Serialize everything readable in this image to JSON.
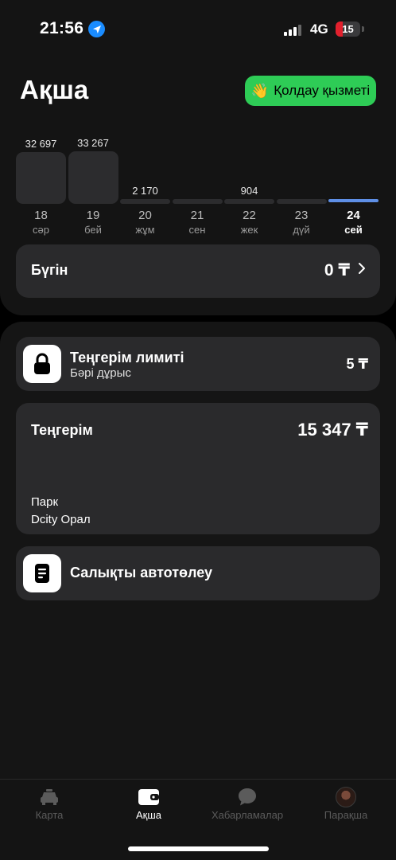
{
  "status": {
    "time": "21:56",
    "network": "4G",
    "battery": "15",
    "location_icon": "location-arrow-icon",
    "signal_icon": "cellular-signal-icon"
  },
  "header": {
    "title": "Ақша",
    "support_label": "Қолдау қызметі",
    "support_icon": "waving-hand-icon",
    "support_color": "#2ecc56"
  },
  "chart_data": {
    "type": "bar",
    "categories": [
      "18",
      "19",
      "20",
      "21",
      "22",
      "23",
      "24"
    ],
    "weekdays": [
      "сәр",
      "бей",
      "жұм",
      "сен",
      "жек",
      "дүй",
      "сей"
    ],
    "value_labels": [
      "32 697",
      "33 267",
      "2 170",
      "",
      "904",
      "",
      ""
    ],
    "values": [
      32697,
      33267,
      2170,
      0,
      904,
      0,
      0
    ],
    "selected_index": 6,
    "bar_color": "#2c2c2e",
    "selected_color": "#5e8fe6"
  },
  "today": {
    "label": "Бүгін",
    "amount": "0 ₸",
    "chevron_icon": "chevron-right-icon"
  },
  "limit_card": {
    "title": "Теңгерім лимиті",
    "subtitle": "Бәрі дұрыс",
    "amount": "5 ₸",
    "icon": "lock-icon"
  },
  "balance_card": {
    "title": "Теңгерім",
    "amount": "15 347 ₸",
    "park_label": "Парк",
    "park_value": "Dcity Орал"
  },
  "tax_card": {
    "title": "Салықты автотөлеу",
    "icon": "document-icon"
  },
  "tabs": [
    {
      "label": "Карта",
      "icon": "car-icon",
      "active": false
    },
    {
      "label": "Ақша",
      "icon": "wallet-icon",
      "active": true
    },
    {
      "label": "Хабарламалар",
      "icon": "chat-bubble-icon",
      "active": false
    },
    {
      "label": "Парақша",
      "icon": "avatar-icon",
      "active": false
    }
  ]
}
